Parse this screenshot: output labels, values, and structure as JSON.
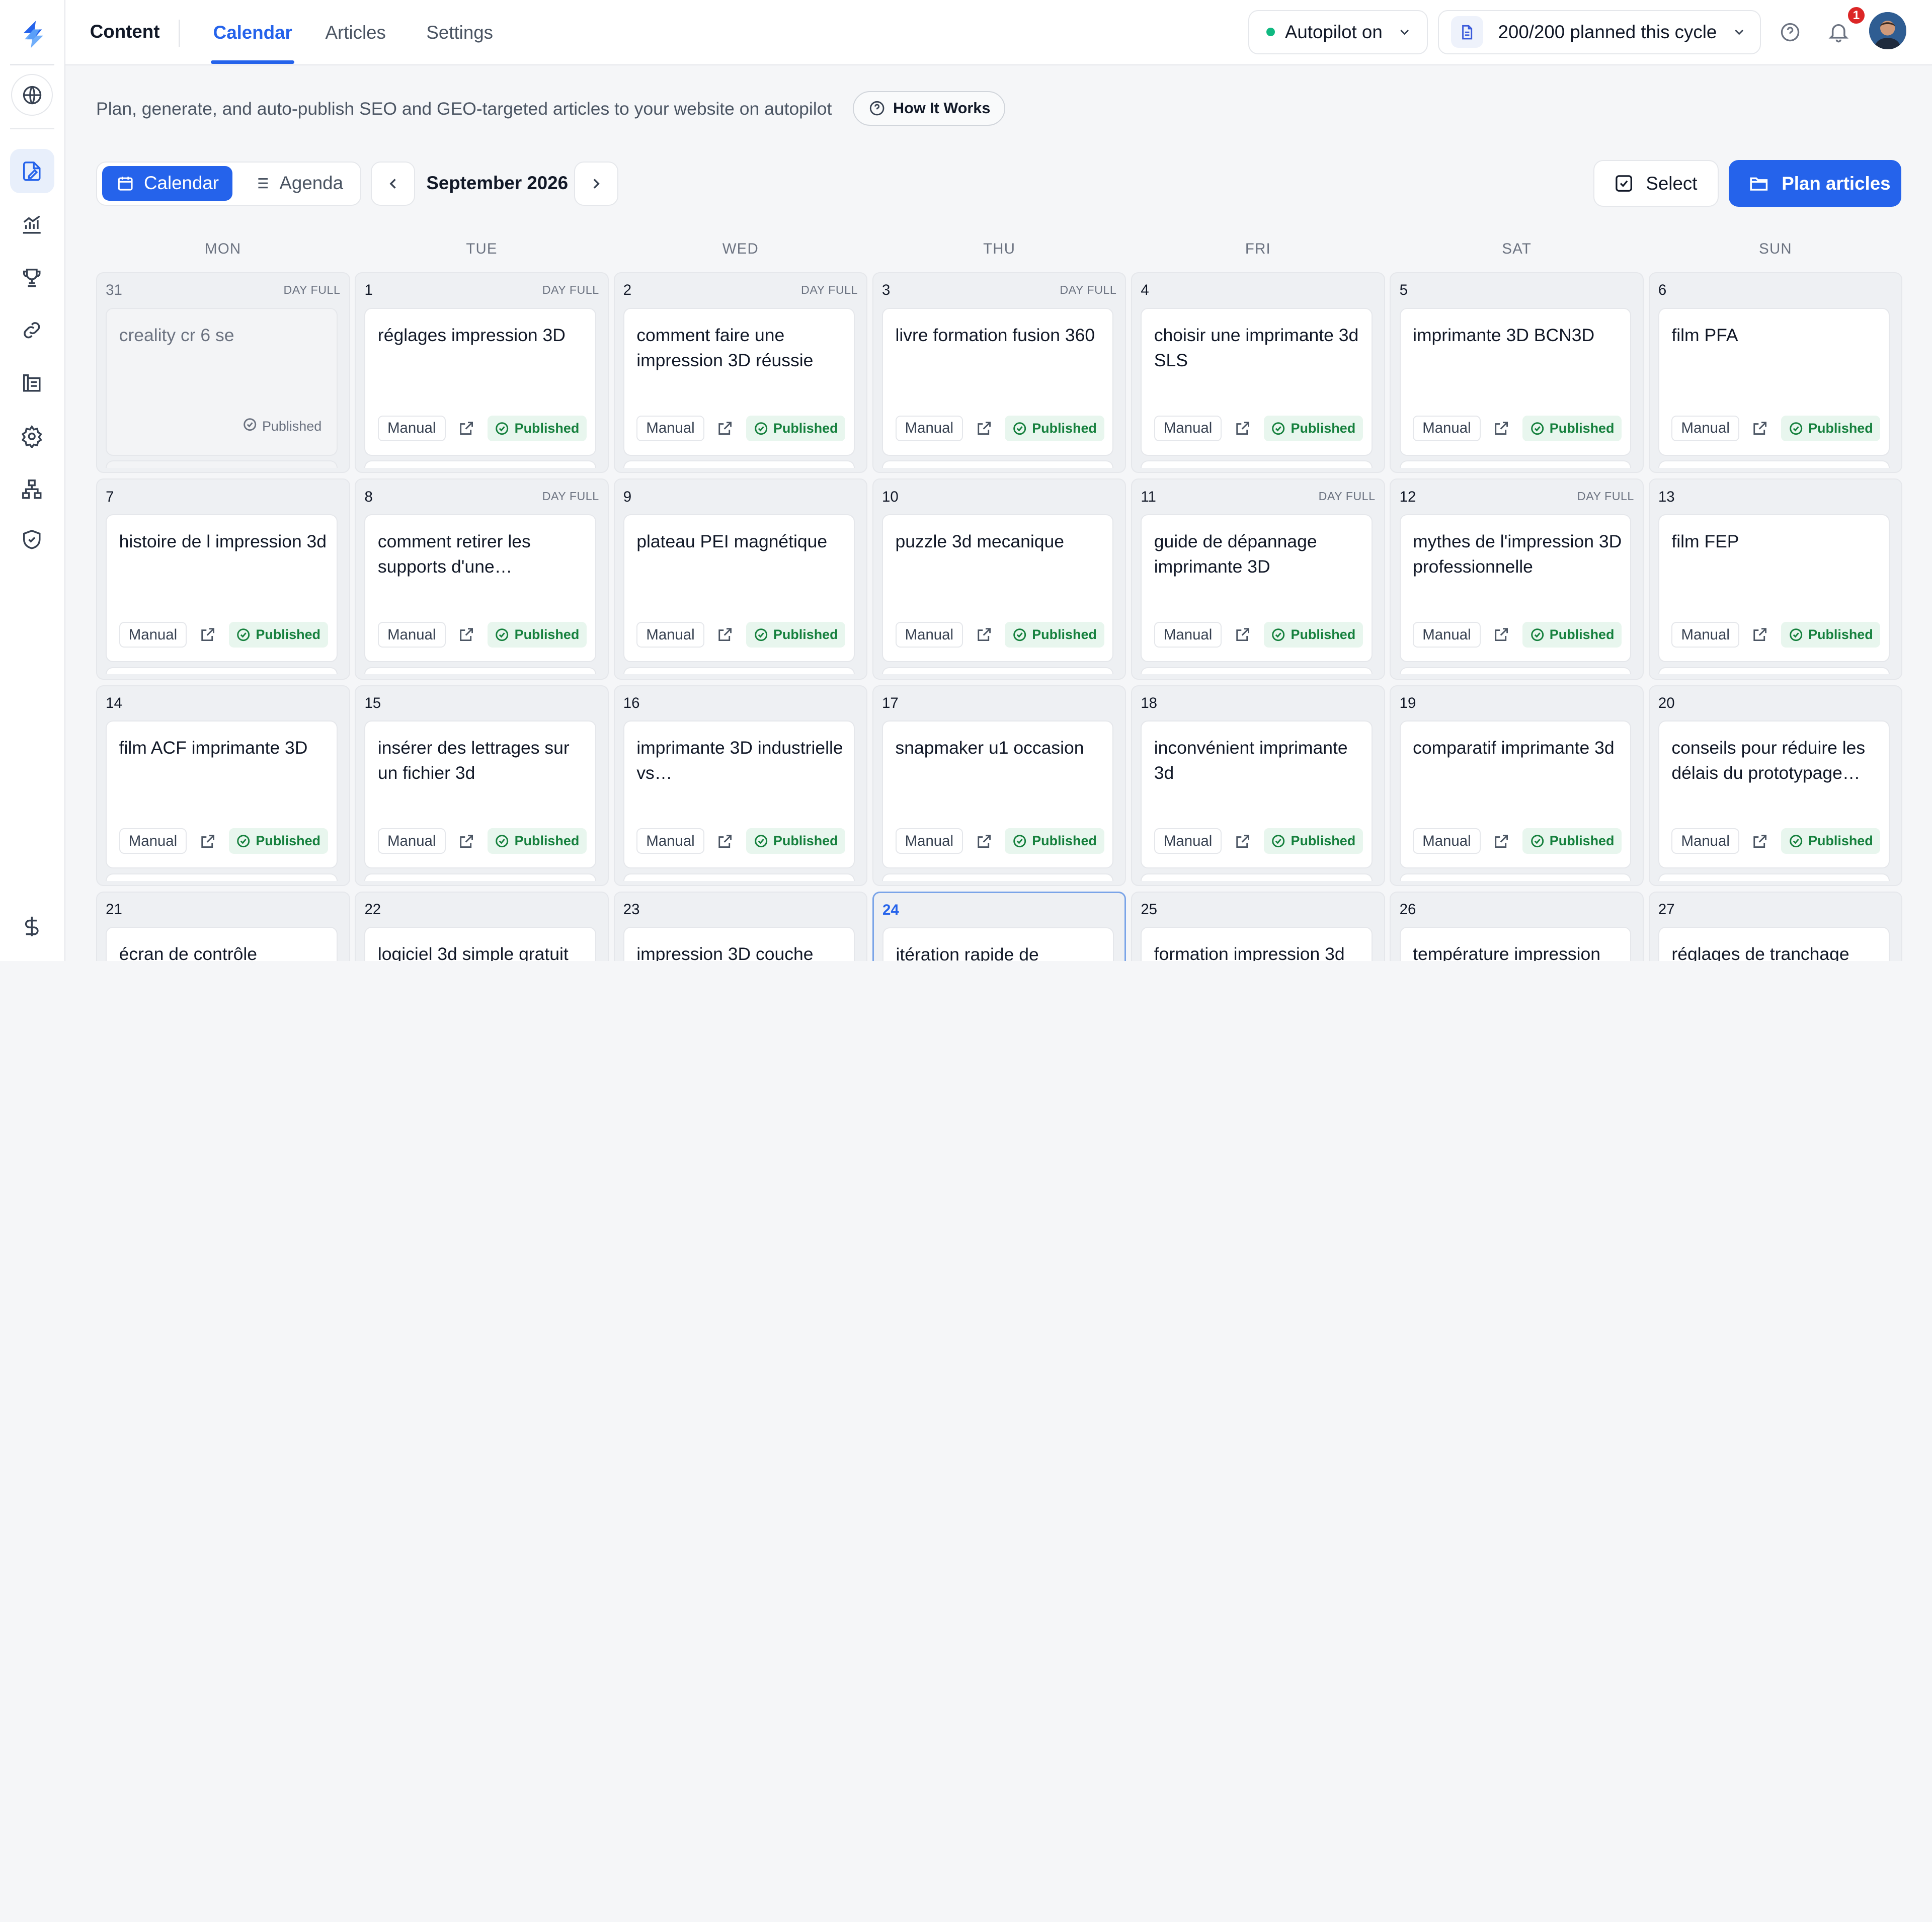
{
  "sidebar": {
    "items": [
      {
        "name": "logo-icon"
      },
      {
        "name": "globe-icon"
      },
      {
        "name": "content-icon"
      },
      {
        "name": "analytics-icon"
      },
      {
        "name": "trophy-icon"
      },
      {
        "name": "link-icon"
      },
      {
        "name": "catalog-icon"
      },
      {
        "name": "gear-icon"
      },
      {
        "name": "sitemap-icon"
      },
      {
        "name": "shield-icon"
      },
      {
        "name": "dollar-icon"
      }
    ]
  },
  "topbar": {
    "title": "Content",
    "tabs": [
      {
        "label": "Calendar",
        "active": true
      },
      {
        "label": "Articles",
        "active": false
      },
      {
        "label": "Settings",
        "active": false
      }
    ],
    "autopilot": {
      "label": "Autopilot on",
      "status_color": "#10b981"
    },
    "plan_counter": {
      "label": "200/200 planned this cycle"
    },
    "notifications_count": "1"
  },
  "subheader": {
    "description": "Plan, generate, and auto-publish SEO and GEO-targeted articles to your website on autopilot",
    "how_it_works": "How It Works"
  },
  "toolbar": {
    "view_calendar": "Calendar",
    "view_agenda": "Agenda",
    "month": "September 2026",
    "select": "Select",
    "plan_articles": "Plan articles"
  },
  "calendar": {
    "weekdays": [
      "MON",
      "TUE",
      "WED",
      "THU",
      "FRI",
      "SAT",
      "SUN"
    ],
    "day_full_label": "DAY FULL",
    "manual_label": "Manual",
    "published_label": "Published",
    "weeks": [
      [
        {
          "day": "31",
          "outside": true,
          "full": true,
          "title": "creality cr 6 se"
        },
        {
          "day": "1",
          "full": true,
          "title": "réglages impression 3D"
        },
        {
          "day": "2",
          "full": true,
          "title": "comment faire une impression 3D réussie"
        },
        {
          "day": "3",
          "full": true,
          "title": "livre formation fusion 360"
        },
        {
          "day": "4",
          "title": "choisir une imprimante 3d SLS"
        },
        {
          "day": "5",
          "title": "imprimante 3D BCN3D"
        },
        {
          "day": "6",
          "title": "film PFA"
        }
      ],
      [
        {
          "day": "7",
          "title": "histoire de l impression 3d"
        },
        {
          "day": "8",
          "full": true,
          "title": "comment retirer les supports d'une…"
        },
        {
          "day": "9",
          "title": "plateau PEI magnétique"
        },
        {
          "day": "10",
          "title": "puzzle 3d mecanique"
        },
        {
          "day": "11",
          "full": true,
          "title": "guide de dépannage imprimante 3D"
        },
        {
          "day": "12",
          "full": true,
          "title": "mythes de l'impression 3D professionnelle"
        },
        {
          "day": "13",
          "title": "film FEP"
        }
      ],
      [
        {
          "day": "14",
          "title": "film ACF imprimante 3D"
        },
        {
          "day": "15",
          "title": "insérer des lettrages sur un fichier 3d"
        },
        {
          "day": "16",
          "title": "imprimante 3D industrielle vs…"
        },
        {
          "day": "17",
          "title": "snapmaker u1 occasion"
        },
        {
          "day": "18",
          "title": "inconvénient imprimante 3d"
        },
        {
          "day": "19",
          "title": "comparatif imprimante 3d"
        },
        {
          "day": "20",
          "title": "conseils pour réduire les délais du prototypage…"
        }
      ],
      [
        {
          "day": "21",
          "title": "écran de contrôle"
        },
        {
          "day": "22",
          "title": "logiciel 3d simple gratuit"
        },
        {
          "day": "23",
          "title": "impression 3D couche"
        },
        {
          "day": "24",
          "today": true,
          "title": "itération rapide de"
        },
        {
          "day": "25",
          "title": "formation impression 3d"
        },
        {
          "day": "26",
          "title": "température impression"
        },
        {
          "day": "27",
          "title": "réglages de tranchage"
        }
      ]
    ]
  }
}
